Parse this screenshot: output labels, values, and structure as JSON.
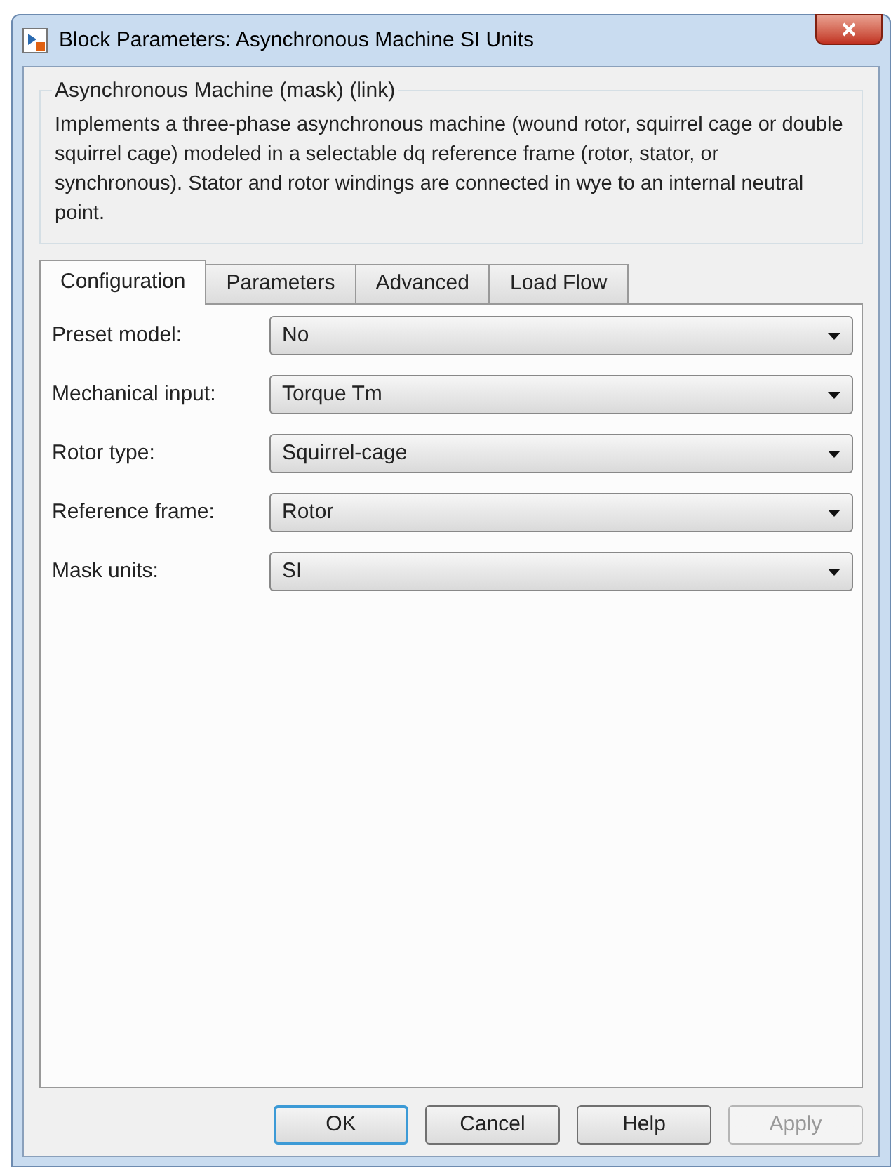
{
  "window": {
    "title": "Block Parameters: Asynchronous Machine SI Units"
  },
  "group": {
    "title": "Asynchronous Machine (mask) (link)",
    "description": "Implements a three-phase asynchronous machine (wound rotor, squirrel cage or double squirrel cage) modeled in a selectable dq reference frame (rotor, stator, or synchronous). Stator and rotor windings are connected in wye to an internal neutral point."
  },
  "tabs": [
    {
      "label": "Configuration",
      "selected": true
    },
    {
      "label": "Parameters",
      "selected": false
    },
    {
      "label": "Advanced",
      "selected": false
    },
    {
      "label": "Load Flow",
      "selected": false
    }
  ],
  "fields": [
    {
      "label": "Preset model:",
      "value": "No"
    },
    {
      "label": "Mechanical input:",
      "value": "Torque Tm"
    },
    {
      "label": "Rotor type:",
      "value": "Squirrel-cage"
    },
    {
      "label": "Reference frame:",
      "value": "Rotor"
    },
    {
      "label": "Mask units:",
      "value": "SI"
    }
  ],
  "buttons": [
    {
      "label": "OK",
      "default": true,
      "disabled": false
    },
    {
      "label": "Cancel",
      "default": false,
      "disabled": false
    },
    {
      "label": "Help",
      "default": false,
      "disabled": false
    },
    {
      "label": "Apply",
      "default": false,
      "disabled": true
    }
  ]
}
